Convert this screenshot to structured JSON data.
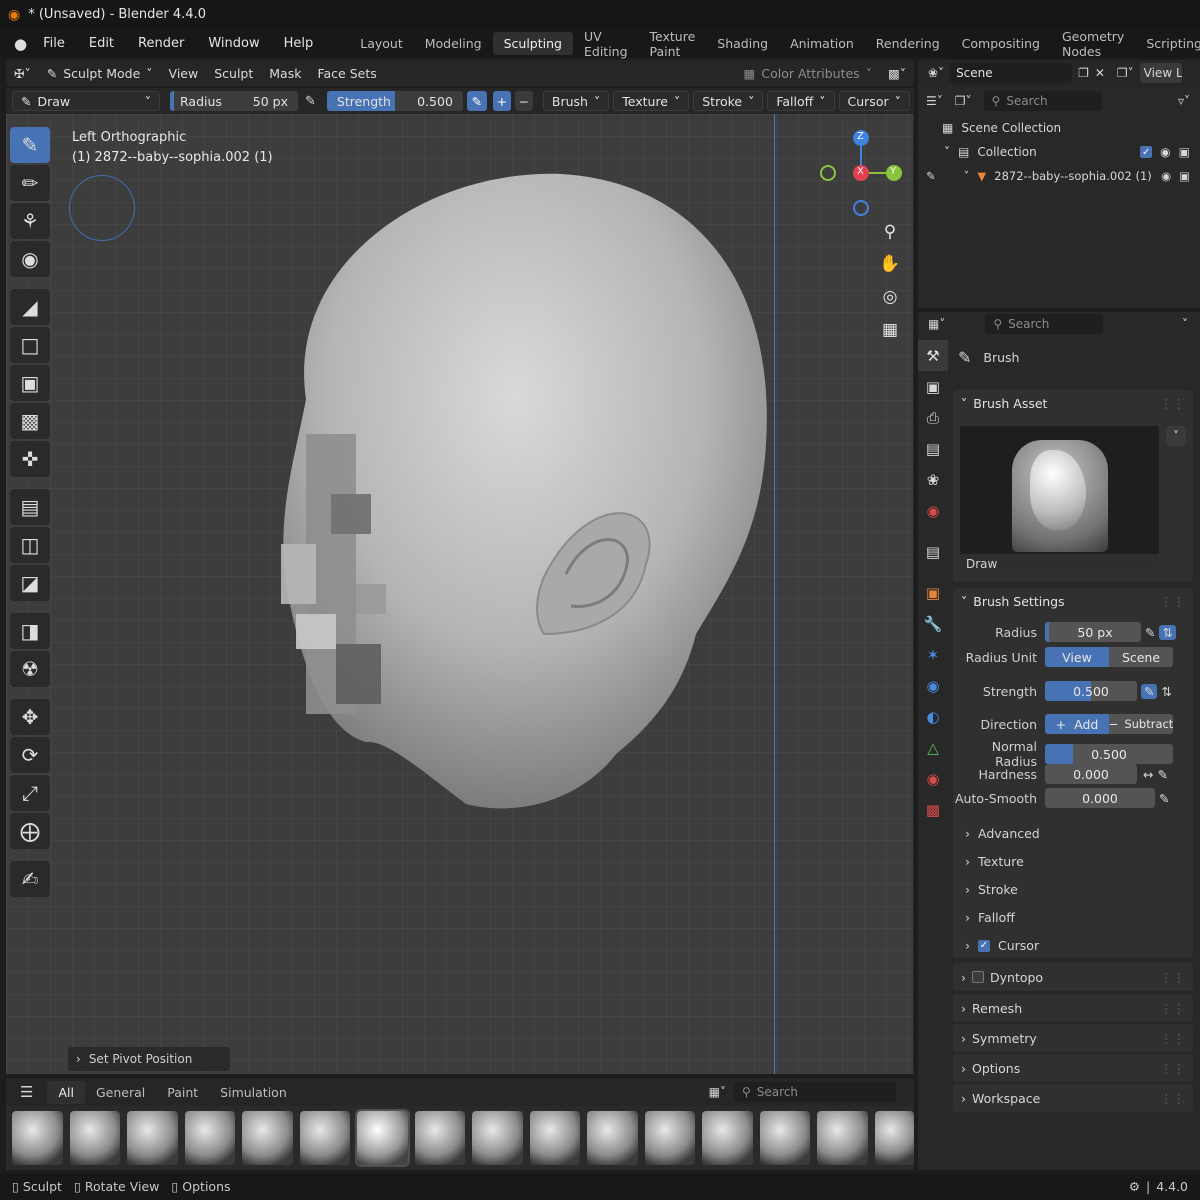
{
  "window": {
    "title": "* (Unsaved) - Blender 4.4.0"
  },
  "menus": [
    "File",
    "Edit",
    "Render",
    "Window",
    "Help"
  ],
  "workspaces": [
    {
      "label": "Layout",
      "active": false
    },
    {
      "label": "Modeling",
      "active": false
    },
    {
      "label": "Sculpting",
      "active": true
    },
    {
      "label": "UV Editing",
      "active": false
    },
    {
      "label": "Texture Paint",
      "active": false
    },
    {
      "label": "Shading",
      "active": false
    },
    {
      "label": "Animation",
      "active": false
    },
    {
      "label": "Rendering",
      "active": false
    },
    {
      "label": "Compositing",
      "active": false
    },
    {
      "label": "Geometry Nodes",
      "active": false
    },
    {
      "label": "Scripting",
      "active": false
    }
  ],
  "viewport_header": {
    "mode": "Sculpt Mode",
    "menus": [
      "View",
      "Sculpt",
      "Mask",
      "Face Sets"
    ],
    "color_attributes": "Color Attributes"
  },
  "tool_settings": {
    "brush": "Draw",
    "radius_label": "Radius",
    "radius_value": "50 px",
    "strength_label": "Strength",
    "strength_value": "0.500",
    "menus": [
      "Brush",
      "Texture",
      "Stroke",
      "Falloff",
      "Cursor"
    ]
  },
  "viewport": {
    "view_name": "Left Orthographic",
    "object_label": "(1) 2872--baby--sophia.002 (1)",
    "last_operator": "Set Pivot Position",
    "gizmo": {
      "z": "Z",
      "x": "X",
      "y": "Y"
    }
  },
  "scene_header": {
    "scene": "Scene",
    "view_layer": "View La"
  },
  "outliner": {
    "search_placeholder": "Search",
    "scene_collection": "Scene Collection",
    "collection": "Collection",
    "object": "2872--baby--sophia.002 (1)"
  },
  "properties": {
    "search_placeholder": "Search",
    "context": "Brush",
    "brush_asset": {
      "header": "Brush Asset",
      "name": "Draw"
    },
    "brush_settings": {
      "header": "Brush Settings",
      "radius": {
        "label": "Radius",
        "value": "50 px",
        "fill": 0.0
      },
      "radius_unit": {
        "label": "Radius Unit",
        "options": [
          "View",
          "Scene"
        ],
        "selected": "View"
      },
      "strength": {
        "label": "Strength",
        "value": "0.500",
        "fill": 0.5
      },
      "direction": {
        "label": "Direction",
        "add": "Add",
        "subtract": "Subtract",
        "selected": "Add"
      },
      "normal_radius": {
        "label": "Normal Radius",
        "value": "0.500",
        "fill": 0.22
      },
      "hardness": {
        "label": "Hardness",
        "value": "0.000",
        "fill": 0.0
      },
      "auto_smooth": {
        "label": "Auto-Smooth",
        "value": "0.000",
        "fill": 0.0
      }
    },
    "subpanels": [
      {
        "label": "Advanced",
        "checkbox": false
      },
      {
        "label": "Texture",
        "checkbox": false
      },
      {
        "label": "Stroke",
        "checkbox": false
      },
      {
        "label": "Falloff",
        "checkbox": false
      },
      {
        "label": "Cursor",
        "checkbox": true
      }
    ],
    "panels": [
      {
        "label": "Dyntopo",
        "checkbox": true,
        "checked": false
      },
      {
        "label": "Remesh",
        "checkbox": false
      },
      {
        "label": "Symmetry",
        "checkbox": false
      },
      {
        "label": "Options",
        "checkbox": false
      },
      {
        "label": "Workspace",
        "checkbox": false
      }
    ]
  },
  "asset_shelf": {
    "tabs": [
      {
        "label": "All",
        "active": true
      },
      {
        "label": "General",
        "active": false
      },
      {
        "label": "Paint",
        "active": false
      },
      {
        "label": "Simulation",
        "active": false
      }
    ],
    "search_placeholder": "Search"
  },
  "statusbar": {
    "items": [
      "Sculpt",
      "Rotate View",
      "Options"
    ],
    "version": "4.4.0"
  },
  "colors": {
    "accent": "#4772b3",
    "gizmo_x": "#e34150",
    "gizmo_y": "#8bc33e",
    "gizmo_z": "#3f82e0"
  }
}
